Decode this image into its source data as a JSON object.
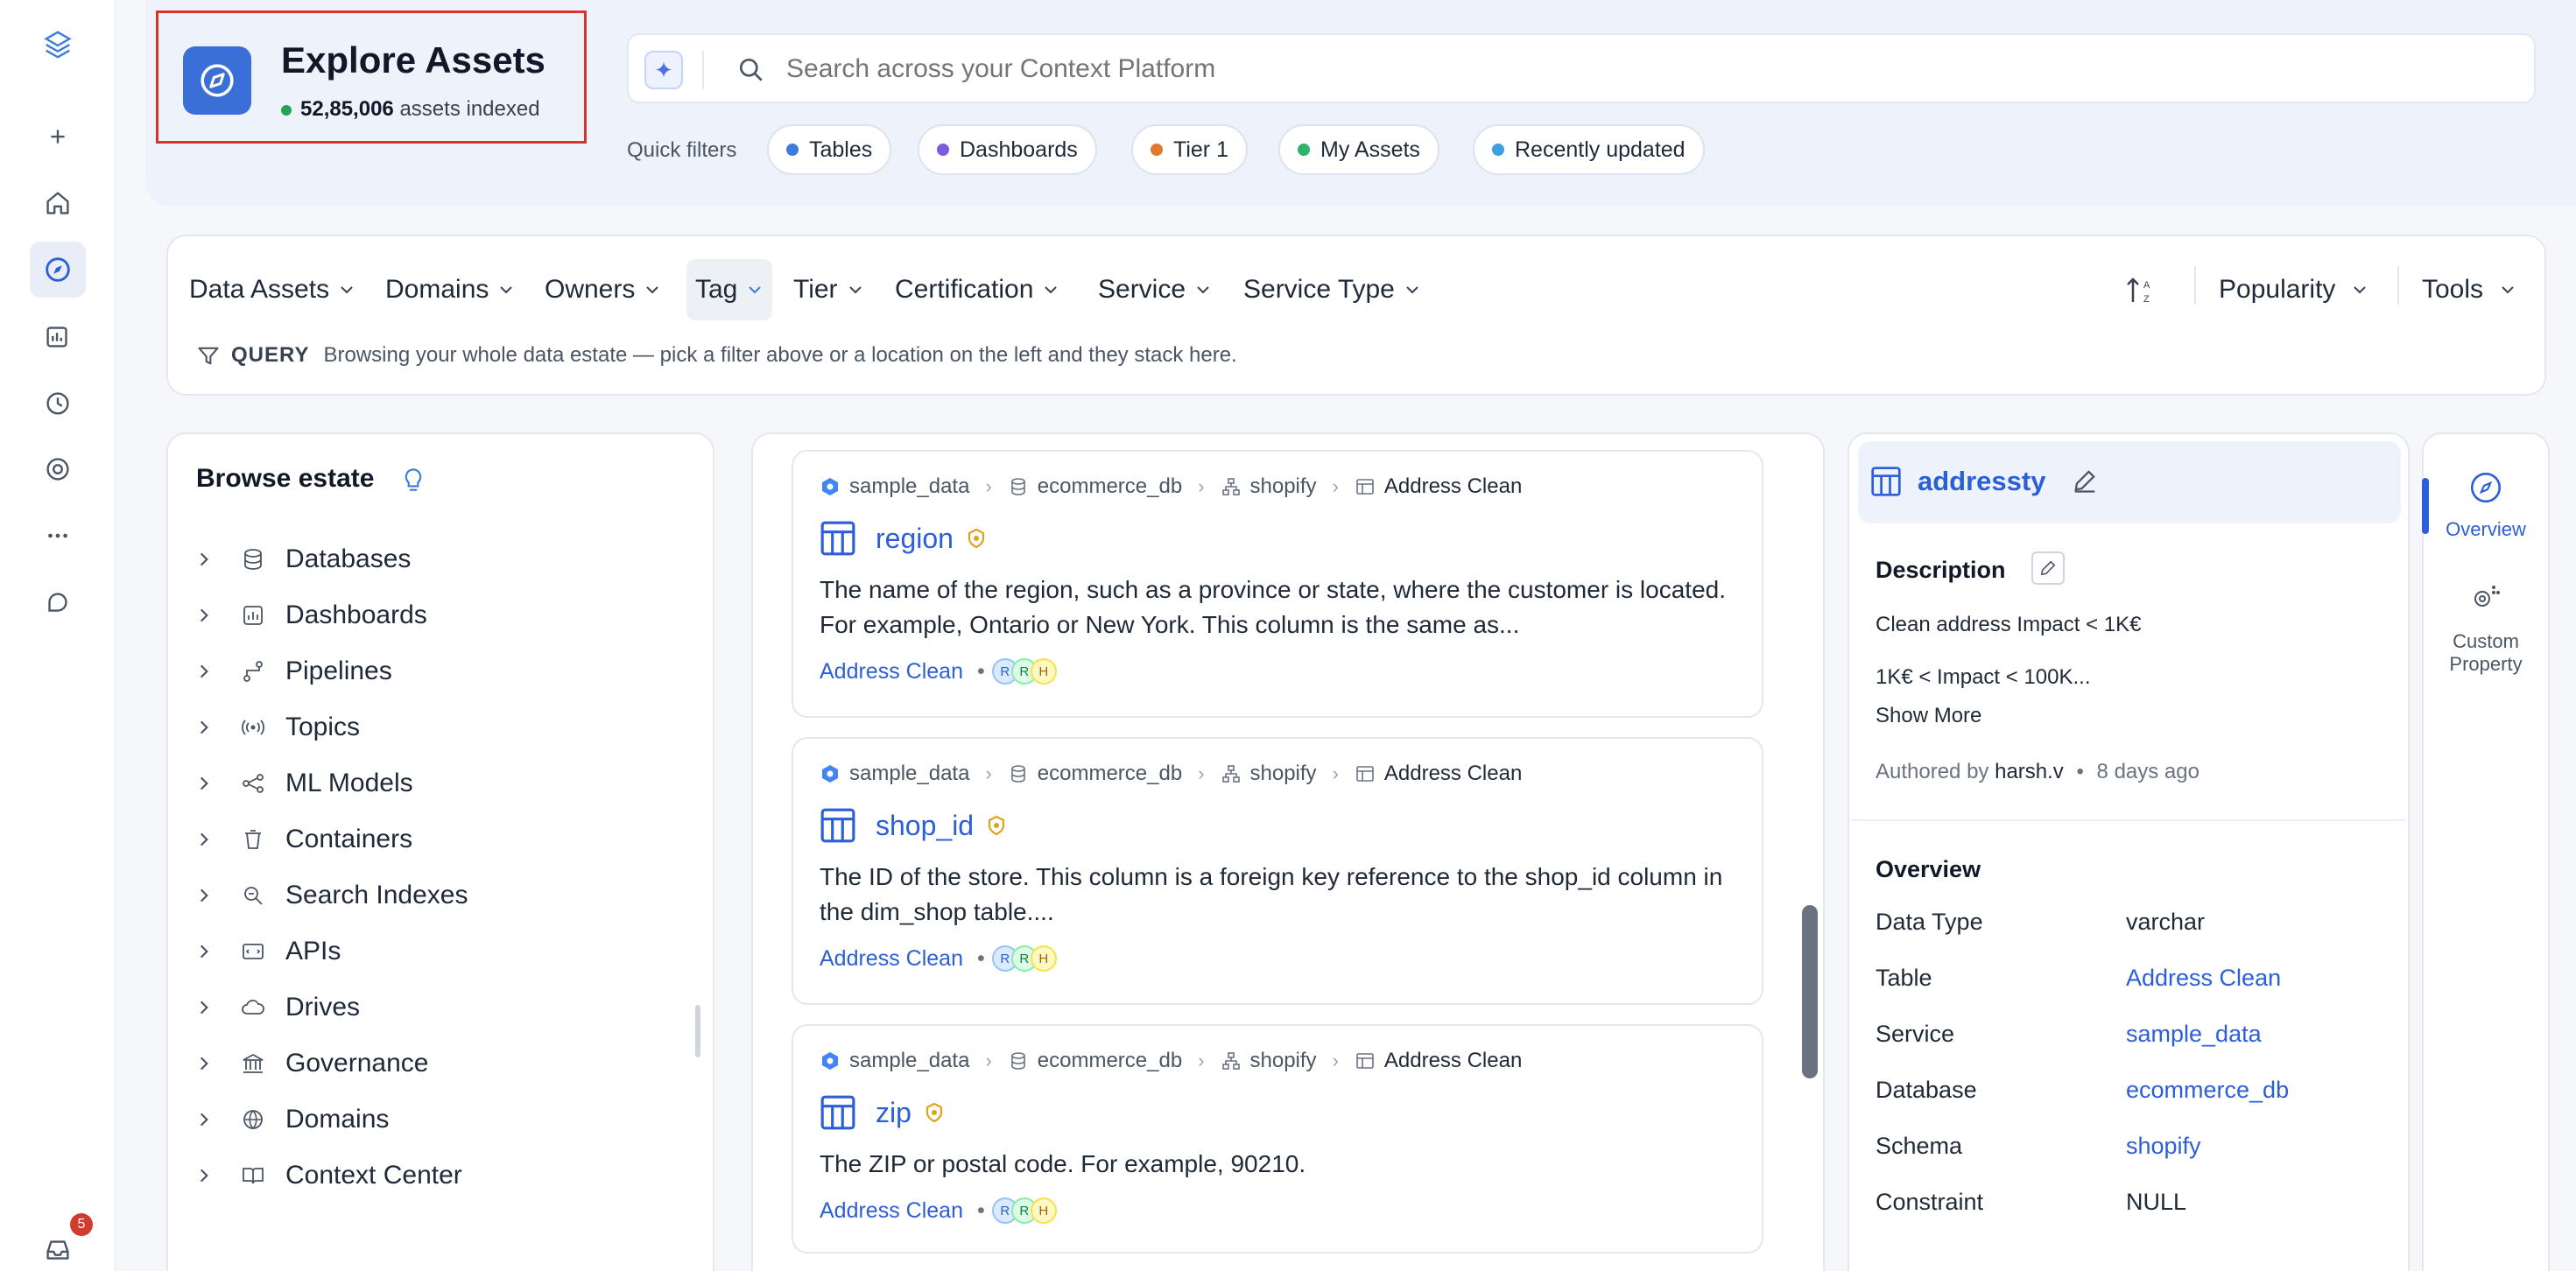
{
  "header": {
    "title": "Explore Assets",
    "count": "52,85,006",
    "count_suffix": "assets indexed",
    "search_placeholder": "Search across your Context Platform",
    "quick_filters_label": "Quick filters",
    "quick_filters": [
      {
        "label": "Tables",
        "color": "#3b7be0"
      },
      {
        "label": "Dashboards",
        "color": "#7b5ce0"
      },
      {
        "label": "Tier 1",
        "color": "#e07a2e"
      },
      {
        "label": "My Assets",
        "color": "#2fb36a"
      },
      {
        "label": "Recently updated",
        "color": "#3aa0e0"
      }
    ]
  },
  "filters": {
    "items": [
      "Data Assets",
      "Domains",
      "Owners",
      "Tag",
      "Tier",
      "Certification",
      "Service",
      "Service Type"
    ],
    "sort_label": "Popularity",
    "tools_label": "Tools",
    "query_label": "QUERY",
    "query_text": "Browsing your whole data estate — pick a filter above or a location on the left and they stack here."
  },
  "browse": {
    "title": "Browse estate",
    "items": [
      "Databases",
      "Dashboards",
      "Pipelines",
      "Topics",
      "ML Models",
      "Containers",
      "Search Indexes",
      "APIs",
      "Drives",
      "Governance",
      "Domains",
      "Context Center"
    ]
  },
  "results": [
    {
      "breadcrumb": [
        "sample_data",
        "ecommerce_db",
        "shopify",
        "Address Clean"
      ],
      "name": "region",
      "description": "The name of the region, such as a province or state, where the customer is located. For example, Ontario or New York. This column is the same as...",
      "table_link": "Address Clean",
      "avatars": [
        "R",
        "R",
        "H"
      ]
    },
    {
      "breadcrumb": [
        "sample_data",
        "ecommerce_db",
        "shopify",
        "Address Clean"
      ],
      "name": "shop_id",
      "description": "The ID of the store. This column is a foreign key reference to the shop_id column in the dim_shop table....",
      "table_link": "Address Clean",
      "avatars": [
        "R",
        "R",
        "H"
      ]
    },
    {
      "breadcrumb": [
        "sample_data",
        "ecommerce_db",
        "shopify",
        "Address Clean"
      ],
      "name": "zip",
      "description": "The ZIP or postal code. For example, 90210.",
      "table_link": "Address Clean",
      "avatars": [
        "R",
        "R",
        "H"
      ]
    }
  ],
  "detail": {
    "title": "addressty",
    "description_label": "Description",
    "description_line1": "Clean address Impact < 1K€",
    "description_line2": "1K€ < Impact < 100K...",
    "show_more": "Show More",
    "authored_by_label": "Authored by",
    "author": "harsh.v",
    "authored_when": "8 days ago",
    "overview_label": "Overview",
    "rows": [
      {
        "label": "Data Type",
        "value": "varchar",
        "link": false
      },
      {
        "label": "Table",
        "value": "Address Clean",
        "link": true
      },
      {
        "label": "Service",
        "value": "sample_data",
        "link": true
      },
      {
        "label": "Database",
        "value": "ecommerce_db",
        "link": true
      },
      {
        "label": "Schema",
        "value": "shopify",
        "link": true
      },
      {
        "label": "Constraint",
        "value": "NULL",
        "link": false
      }
    ]
  },
  "right_tabs": {
    "overview": "Overview",
    "custom_property_1": "Custom",
    "custom_property_2": "Property"
  },
  "notifications_count": "5"
}
